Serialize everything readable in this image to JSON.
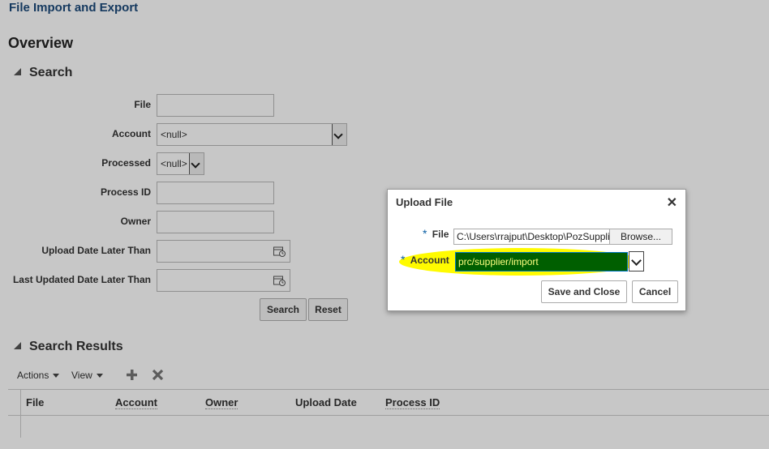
{
  "page": {
    "title": "File Import and Export",
    "overview_heading": "Overview"
  },
  "search": {
    "heading": "Search",
    "fields": {
      "file_label": "File",
      "account_label": "Account",
      "account_value": "<null>",
      "processed_label": "Processed",
      "processed_value": "<null>",
      "process_id_label": "Process ID",
      "owner_label": "Owner",
      "upload_date_label": "Upload Date Later Than",
      "last_updated_label": "Last Updated Date Later Than"
    },
    "search_button": "Search",
    "reset_button": "Reset"
  },
  "results": {
    "heading": "Search Results",
    "actions_label": "Actions",
    "view_label": "View",
    "columns": [
      "File",
      "Account",
      "Owner",
      "Upload Date",
      "Process ID"
    ]
  },
  "dialog": {
    "title": "Upload File",
    "close_symbol": "✕",
    "required_marker": "*",
    "file_label": "File",
    "file_path": "C:\\Users\\rrajput\\Desktop\\PozSuppli",
    "browse_button": "Browse...",
    "account_label": "Account",
    "account_value": "prc/supplier/import",
    "save_close_button": "Save and Close",
    "cancel_button": "Cancel"
  },
  "colors": {
    "highlight": "#fffb00",
    "selection": "#005f00",
    "title_blue": "#1c4a7a"
  }
}
